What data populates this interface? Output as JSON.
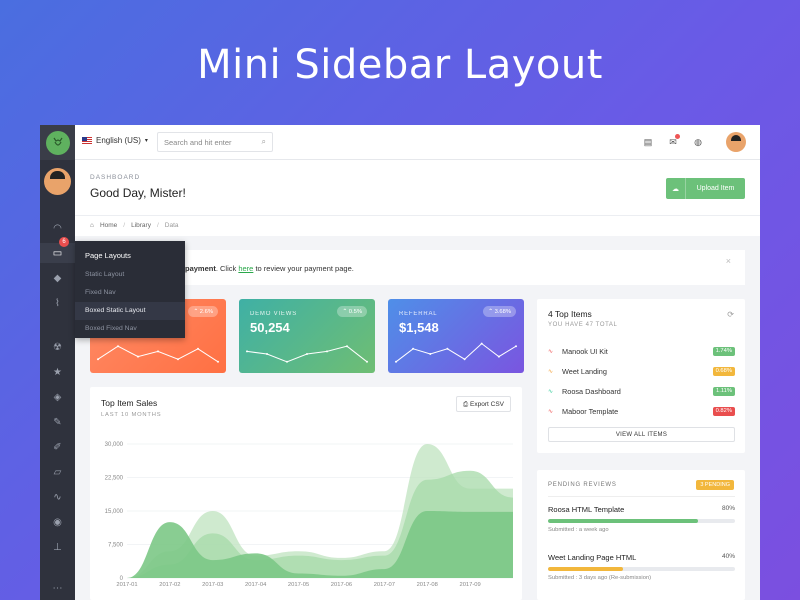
{
  "hero_title": "Mini Sidebar Layout",
  "topbar": {
    "language": "English (US)",
    "search_placeholder": "Search and hit enter"
  },
  "sidebar": {
    "badge": "6",
    "icons": [
      "dashboard-icon",
      "folder-icon",
      "gem-icon",
      "paperclip-icon",
      "radiation-icon",
      "star-icon",
      "layers-icon",
      "edit-icon",
      "pushpin-icon",
      "ruler-icon",
      "chart-icon",
      "record-icon",
      "sitemap-icon",
      "more-icon"
    ]
  },
  "flyout": {
    "heading": "Page Layouts",
    "items": [
      "Static Layout",
      "Fixed Nav",
      "Boxed Static Layout",
      "Boxed Fixed Nav"
    ],
    "selected": 2
  },
  "page": {
    "overline": "DASHBOARD",
    "title": "Good Day, Mister!",
    "upload_label": "Upload Item"
  },
  "breadcrumb": [
    "Home",
    "Library",
    "Data"
  ],
  "alert": {
    "bold": "payment",
    "text1": ". Click ",
    "link": "here",
    "text2": " to review your payment page."
  },
  "stats": [
    {
      "label": "",
      "value": "",
      "change": "2.6%",
      "color_from": "#ff8a65",
      "color_to": "#ff7043",
      "trend": [
        3,
        8,
        4,
        6,
        3,
        7,
        2
      ]
    },
    {
      "label": "DEMO VIEWS",
      "value": "50,254",
      "change": "0.5%",
      "color_from": "#3fb0a5",
      "color_to": "#6fbe73",
      "trend": [
        6,
        5,
        2,
        5,
        6,
        8,
        2
      ]
    },
    {
      "label": "REFERRAL",
      "value": "$1,548",
      "change": "3.68%",
      "color_from": "#4f8fe8",
      "color_to": "#7a55e0",
      "trend": [
        2,
        7,
        5,
        7,
        3,
        9,
        4,
        8
      ]
    }
  ],
  "sales": {
    "title": "Top Item Sales",
    "subtitle": "LAST 10 MONTHS",
    "export_label": "Export CSV"
  },
  "chart_data": {
    "type": "area",
    "x": [
      "2017-01",
      "2017-02",
      "2017-03",
      "2017-04",
      "2017-05",
      "2017-06",
      "2017-07",
      "2017-08",
      "2017-09"
    ],
    "ylim": [
      0,
      30000
    ],
    "y_ticks": [
      "0",
      "7,500",
      "15,000",
      "22,500",
      "30,000"
    ],
    "series": [
      {
        "values": [
          0,
          12500,
          4000,
          5500,
          1000,
          500,
          2000,
          15000,
          14800,
          14800
        ],
        "color": "#7cc886"
      },
      {
        "values": [
          0,
          6000,
          15000,
          5000,
          6000,
          4500,
          6000,
          30000,
          20000,
          20000
        ],
        "color": "#bfe3bf"
      },
      {
        "values": [
          0,
          3000,
          10000,
          4000,
          5000,
          4000,
          5000,
          22000,
          24000,
          18000
        ],
        "color": "#a6d9a8"
      }
    ]
  },
  "top_items": {
    "title": "4 Top Items",
    "subtitle": "YOU HAVE 47 TOTAL",
    "items": [
      {
        "name": "Manook UI Kit",
        "badge": "1.74%",
        "color": "#6cc17a",
        "trend_color": "#e55"
      },
      {
        "name": "Weet Landing",
        "badge": "0.68%",
        "color": "#f2b73c",
        "trend_color": "#f2a23c"
      },
      {
        "name": "Roosa Dashboard",
        "badge": "1.11%",
        "color": "#6cc17a",
        "trend_color": "#3c9"
      },
      {
        "name": "Maboor Template",
        "badge": "0.82%",
        "color": "#e94e4e",
        "trend_color": "#e55"
      }
    ],
    "view_all": "VIEW ALL ITEMS"
  },
  "pending": {
    "title": "PENDING REVIEWS",
    "badge": "3 PENDING",
    "reviews": [
      {
        "name": "Roosa HTML Template",
        "percent": "80%",
        "fill": 0.8,
        "color": "#6cc17a",
        "sub": "Submitted : a week ago"
      },
      {
        "name": "Weet Landing Page HTML",
        "percent": "40%",
        "fill": 0.4,
        "color": "#f2b73c",
        "sub": "Submitted : 3 days ago (Re-submission)"
      }
    ]
  }
}
